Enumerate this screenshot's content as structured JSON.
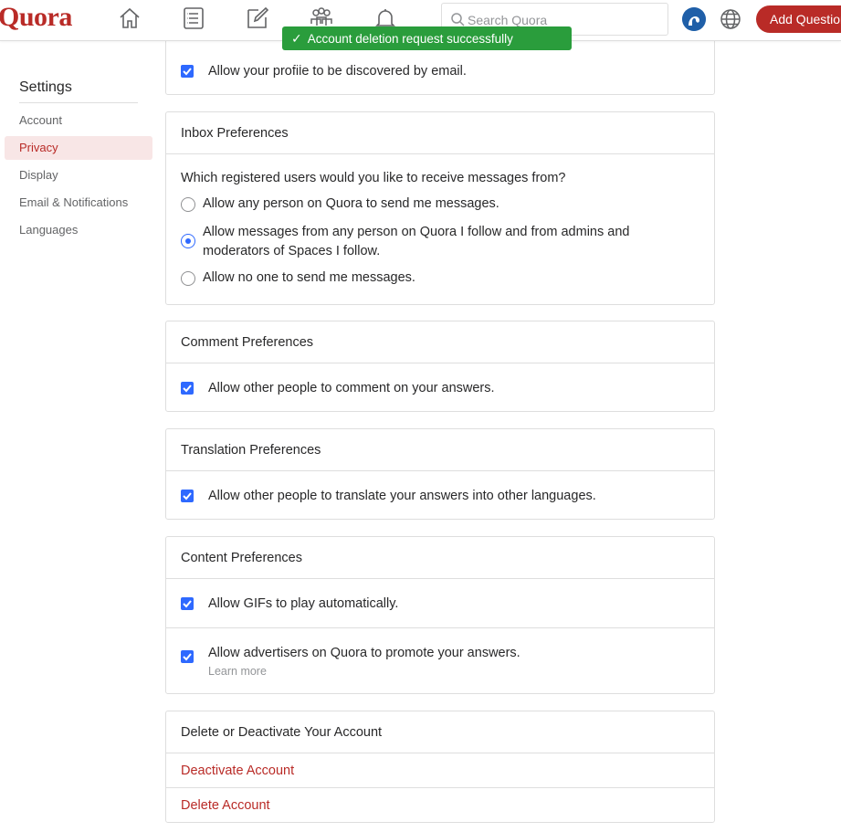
{
  "header": {
    "logo": "Quora",
    "search_placeholder": "Search Quora",
    "add_question_label": "Add Question"
  },
  "toast": {
    "message": "Account deletion request successfully submitted."
  },
  "sidebar": {
    "title": "Settings",
    "items": [
      {
        "label": "Account"
      },
      {
        "label": "Privacy"
      },
      {
        "label": "Display"
      },
      {
        "label": "Email & Notifications"
      },
      {
        "label": "Languages"
      }
    ]
  },
  "discover": {
    "option": "Allow your profile to be discovered by email."
  },
  "inbox": {
    "title": "Inbox Preferences",
    "question": "Which registered users would you like to receive messages from?",
    "options": [
      {
        "label": "Allow any person on Quora to send me messages."
      },
      {
        "label": "Allow messages from any person on Quora I follow and from admins and moderators of Spaces I follow."
      },
      {
        "label": "Allow no one to send me messages."
      }
    ]
  },
  "comment": {
    "title": "Comment Preferences",
    "option": "Allow other people to comment on your answers."
  },
  "translation": {
    "title": "Translation Preferences",
    "option": "Allow other people to translate your answers into other languages."
  },
  "content": {
    "title": "Content Preferences",
    "gif_option": "Allow GIFs to play automatically.",
    "ads_option": "Allow advertisers on Quora to promote your answers.",
    "learn_more": "Learn more"
  },
  "delete": {
    "title": "Delete or Deactivate Your Account",
    "deactivate": "Deactivate Account",
    "delete": "Delete Account"
  },
  "colors": {
    "brand": "#b92b27",
    "accent": "#2e69ff",
    "toast": "#2a9d3c"
  }
}
